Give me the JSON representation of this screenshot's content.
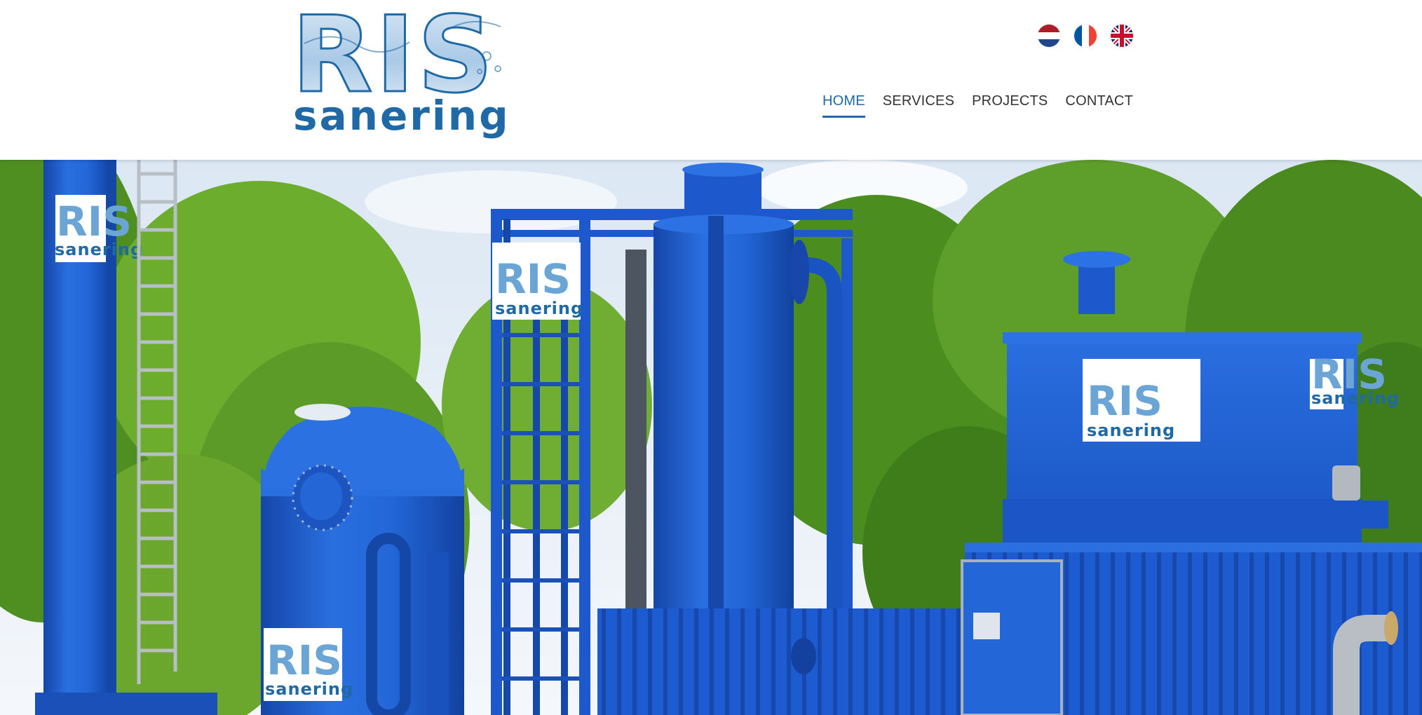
{
  "site": {
    "logo": {
      "main": "RIS",
      "sub": "sanering"
    },
    "languages": [
      {
        "code": "nl",
        "icon": "flag-netherlands-icon"
      },
      {
        "code": "fr",
        "icon": "flag-france-icon"
      },
      {
        "code": "en",
        "icon": "flag-united-kingdom-icon"
      }
    ],
    "nav": {
      "items": [
        {
          "label": "HOME",
          "active": true
        },
        {
          "label": "SERVICES",
          "active": false
        },
        {
          "label": "PROJECTS",
          "active": false
        },
        {
          "label": "CONTACT",
          "active": false
        }
      ]
    }
  },
  "hero": {
    "sign_main": "RIS",
    "sign_sub": "sanering"
  },
  "colors": {
    "brand_blue": "#1f6aa6",
    "equipment_blue": "#1e5fd0",
    "foliage_green": "#5fa52c",
    "nav_text": "#333333"
  }
}
